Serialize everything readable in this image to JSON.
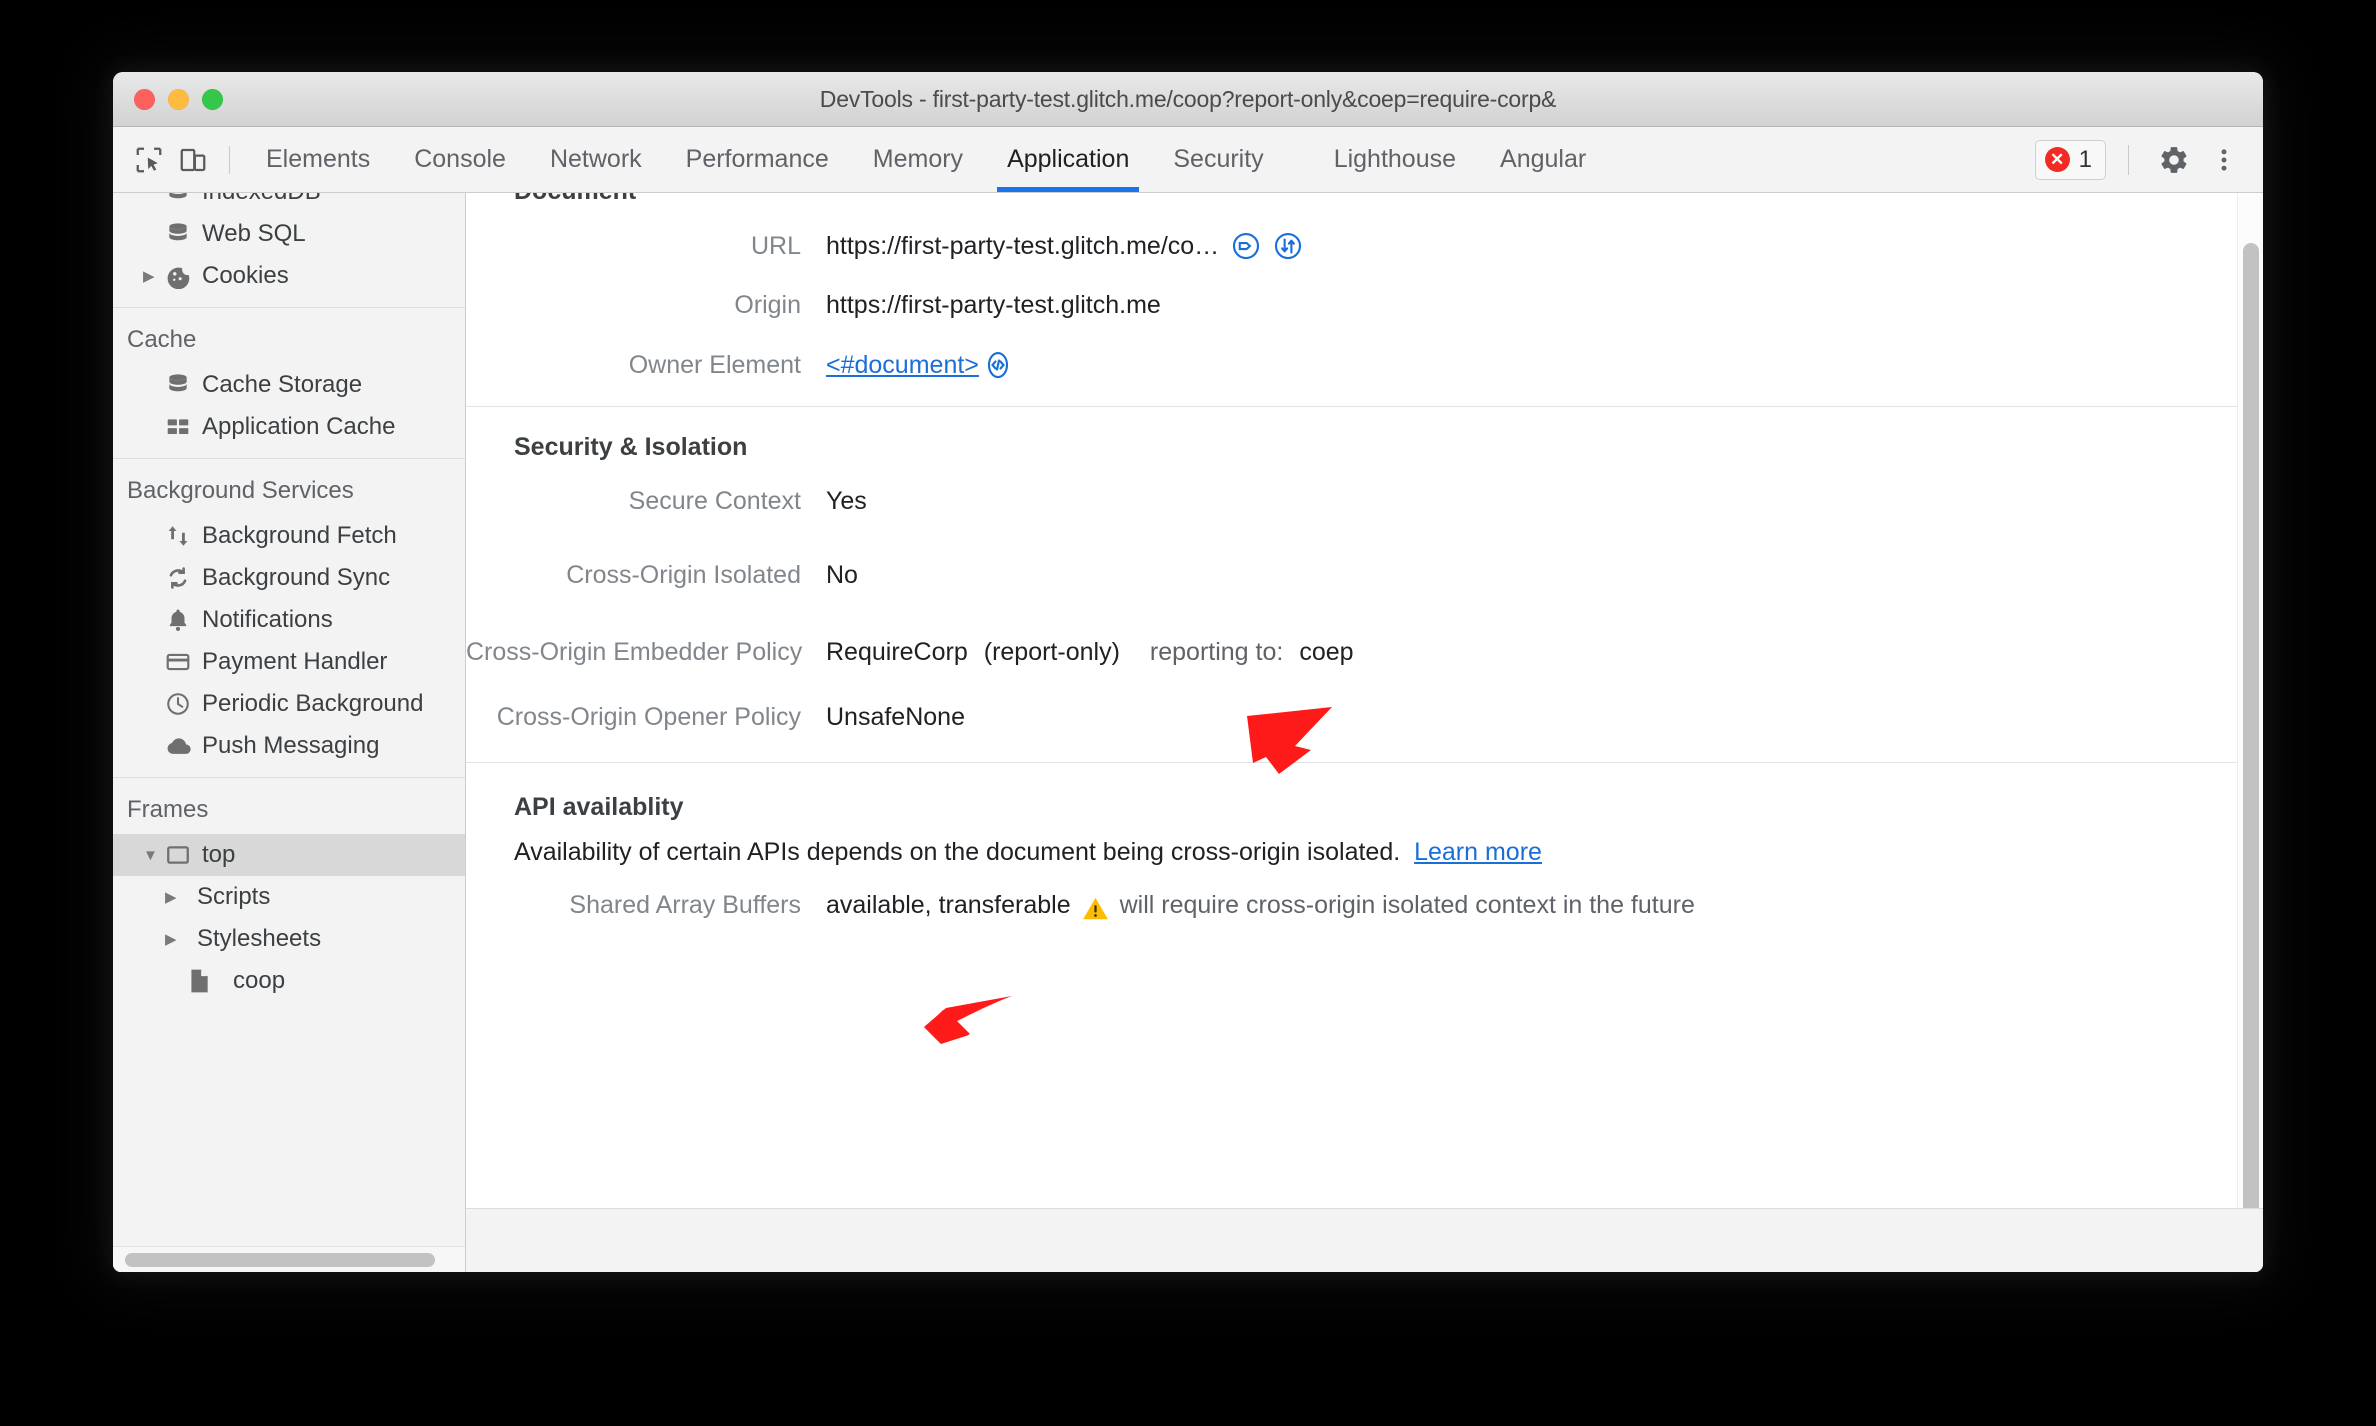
{
  "window": {
    "title": "DevTools - first-party-test.glitch.me/coop?report-only&coep=require-corp&"
  },
  "toolbar": {
    "inspect_icon": "inspect-element-icon",
    "device_icon": "device-toolbar-icon",
    "tabs": [
      {
        "label": "Elements",
        "active": false
      },
      {
        "label": "Console",
        "active": false
      },
      {
        "label": "Network",
        "active": false
      },
      {
        "label": "Performance",
        "active": false
      },
      {
        "label": "Memory",
        "active": false
      },
      {
        "label": "Application",
        "active": true
      },
      {
        "label": "Security",
        "active": false
      },
      {
        "label": "Lighthouse",
        "active": false
      },
      {
        "label": "Angular",
        "active": false
      }
    ],
    "error_badge": {
      "icon": "error-circle-icon",
      "count": "1"
    },
    "settings_icon": "gear-icon",
    "more_icon": "more-vertical-icon"
  },
  "sidebar": {
    "groups": [
      {
        "header": null,
        "items": [
          {
            "label": "IndexedDB",
            "icon": "database-icon",
            "twisty": false,
            "indent": 0,
            "selected": false,
            "clipped": true
          },
          {
            "label": "Web SQL",
            "icon": "database-icon",
            "twisty": false,
            "indent": 0,
            "selected": false
          },
          {
            "label": "Cookies",
            "icon": "cookie-icon",
            "twisty": true,
            "indent": 0,
            "selected": false
          }
        ]
      },
      {
        "header": "Cache",
        "items": [
          {
            "label": "Cache Storage",
            "icon": "database-icon",
            "twisty": false,
            "indent": 0,
            "selected": false
          },
          {
            "label": "Application Cache",
            "icon": "grid-icon",
            "twisty": false,
            "indent": 0,
            "selected": false
          }
        ]
      },
      {
        "header": "Background Services",
        "items": [
          {
            "label": "Background Fetch",
            "icon": "arrows-up-down-icon",
            "twisty": false,
            "indent": 0,
            "selected": false
          },
          {
            "label": "Background Sync",
            "icon": "sync-icon",
            "twisty": false,
            "indent": 0,
            "selected": false
          },
          {
            "label": "Notifications",
            "icon": "bell-icon",
            "twisty": false,
            "indent": 0,
            "selected": false
          },
          {
            "label": "Payment Handler",
            "icon": "credit-card-icon",
            "twisty": false,
            "indent": 0,
            "selected": false
          },
          {
            "label": "Periodic Background",
            "icon": "clock-icon",
            "twisty": false,
            "indent": 0,
            "selected": false
          },
          {
            "label": "Push Messaging",
            "icon": "cloud-icon",
            "twisty": false,
            "indent": 0,
            "selected": false
          }
        ]
      },
      {
        "header": "Frames",
        "items": [
          {
            "label": "top",
            "icon": "frame-icon",
            "twisty": true,
            "expanded": true,
            "indent": 0,
            "selected": true
          },
          {
            "label": "Scripts",
            "icon": null,
            "twisty": true,
            "indent": 1,
            "selected": false
          },
          {
            "label": "Stylesheets",
            "icon": null,
            "twisty": true,
            "indent": 1,
            "selected": false
          },
          {
            "label": "coop",
            "icon": "file-icon",
            "twisty": false,
            "indent": 2,
            "selected": false
          }
        ]
      }
    ]
  },
  "main": {
    "document_section": {
      "title": "Document",
      "rows": [
        {
          "label": "URL",
          "value": "https://first-party-test.glitch.me/co…",
          "icons": [
            "tag-circle-icon",
            "network-circle-icon"
          ]
        },
        {
          "label": "Origin",
          "value": "https://first-party-test.glitch.me",
          "icons": []
        },
        {
          "label": "Owner Element",
          "value": "<#document>",
          "link": true,
          "icons": [
            "code-circle-icon"
          ]
        }
      ]
    },
    "security_section": {
      "title": "Security & Isolation",
      "rows": [
        {
          "label": "Secure Context",
          "value": "Yes"
        },
        {
          "label": "Cross-Origin Isolated",
          "value": "No"
        },
        {
          "label": "Cross-Origin Embedder Policy",
          "value": "RequireCorp",
          "suffix": "(report-only)",
          "reporting_label": "reporting to:",
          "reporting_value": "coep"
        },
        {
          "label": "Cross-Origin Opener Policy",
          "value": "UnsafeNone"
        }
      ]
    },
    "api_section": {
      "title": "API availablity",
      "description": "Availability of certain APIs depends on the document being cross-origin isolated.",
      "learn_more": "Learn more",
      "rows": [
        {
          "label": "Shared Array Buffers",
          "value": "available, transferable",
          "warning_icon": "warning-triangle-icon",
          "warning_text": "will require cross-origin isolated context in the future"
        }
      ]
    }
  },
  "annotations": {
    "arrow_color": "#FF1A1A",
    "arrows": [
      {
        "name": "arrow-pointing-cross-origin-isolated"
      },
      {
        "name": "arrow-pointing-api-availability"
      }
    ]
  }
}
